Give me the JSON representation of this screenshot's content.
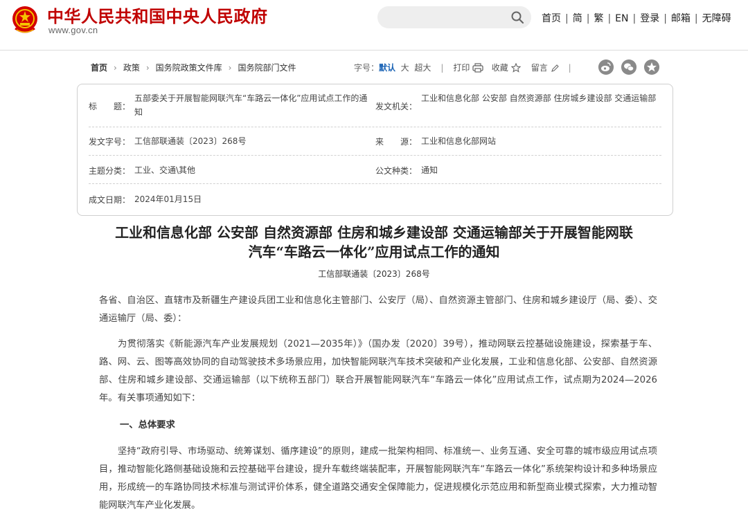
{
  "header": {
    "site_title": "中华人民共和国中央人民政府",
    "site_url": "www.gov.cn",
    "search": {
      "placeholder": ""
    },
    "nav": [
      "首页",
      "简",
      "繁",
      "EN",
      "登录",
      "邮箱",
      "无障碍"
    ]
  },
  "breadcrumb": [
    "首页",
    "政策",
    "国务院政策文件库",
    "国务院部门文件"
  ],
  "tools": {
    "font_label": "字号：",
    "font_sizes": [
      "默认",
      "大",
      "超大"
    ],
    "print": "打印",
    "favorite": "收藏",
    "comment": "留言"
  },
  "share_icons": [
    "weibo-icon",
    "wechat-icon",
    "qzone-icon"
  ],
  "info": {
    "title_label": "标　　题：",
    "title_value": "五部委关于开展智能网联汽车“车路云一体化”应用试点工作的通知",
    "issuer_label": "发文机关：",
    "issuer_value": "工业和信息化部 公安部 自然资源部 住房城乡建设部 交通运输部",
    "docno_label": "发文字号：",
    "docno_value": "工信部联通装〔2023〕268号",
    "source_label": "来　　源：",
    "source_value": "工业和信息化部网站",
    "category_label": "主题分类：",
    "category_value": "工业、交通\\其他",
    "doctype_label": "公文种类：",
    "doctype_value": "通知",
    "date_label": "成文日期：",
    "date_value": "2024年01月15日"
  },
  "article": {
    "headline_line1": "工业和信息化部 公安部 自然资源部 住房和城乡建设部 交通运输部关于开展智能网联",
    "headline_line2": "汽车“车路云一体化”应用试点工作的通知",
    "doc_number": "工信部联通装〔2023〕268号",
    "salutation": "各省、自治区、直辖市及新疆生产建设兵团工业和信息化主管部门、公安厅（局）、自然资源主管部门、住房和城乡建设厅（局、委）、交通运输厅（局、委）：",
    "intro": "为贯彻落实《新能源汽车产业发展规划（2021—2035年）》（国办发〔2020〕39号），推动网联云控基础设施建设，探索基于车、路、网、云、图等高效协同的自动驾驶技术多场景应用，加快智能网联汽车技术突破和产业化发展，工业和信息化部、公安部、自然资源部、住房和城乡建设部、交通运输部（以下统称五部门）联合开展智能网联汽车“车路云一体化”应用试点工作，试点期为2024—2026年。有关事项通知如下：",
    "section1_title": "一、总体要求",
    "section1_body": "坚持“政府引导、市场驱动、统筹谋划、循序建设”的原则，建成一批架构相同、标准统一、业务互通、安全可靠的城市级应用试点项目，推动智能化路侧基础设施和云控基础平台建设，提升车载终端装配率，开展智能网联汽车“车路云一体化”系统架构设计和多种场景应用，形成统一的车路协同技术标准与测试评价体系，健全道路交通安全保障能力，促进规模化示范应用和新型商业模式探索，大力推动智能网联汽车产业化发展。"
  }
}
